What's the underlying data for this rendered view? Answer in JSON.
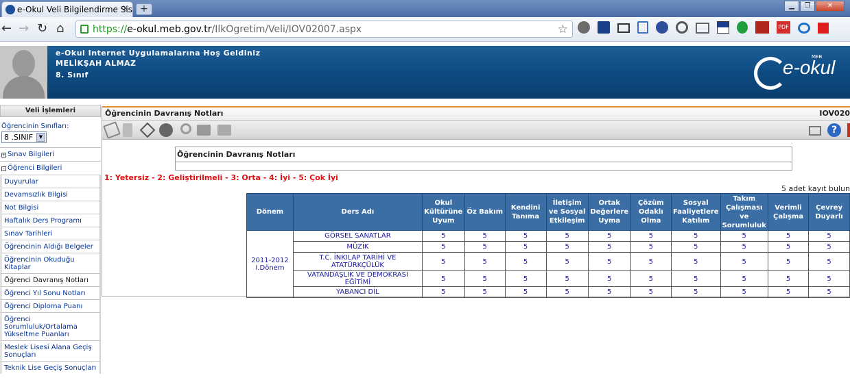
{
  "browser": {
    "tab_title": "e-Okul Veli Bilgilendirme Sistem",
    "url_scheme": "https://",
    "url_host": "e-okul.meb.gov.tr",
    "url_path": "/IlkOgretim/Veli/IOV02007.aspx"
  },
  "header": {
    "welcome": "e-Okul Internet Uygulamalarına Hoş Geldiniz",
    "student_name": "MELİKŞAH ALMAZ",
    "class_label": "8. Sınıf",
    "logo_text": "e-okul",
    "logo_sub": "MEB"
  },
  "sidebar": {
    "title": "Veli İşlemleri",
    "class_select_label": "Öğrencinin Sınıfları:",
    "class_select_value": "8 .SINIF",
    "groups": [
      {
        "label": "Sınav Bilgileri"
      },
      {
        "label": "Öğrenci Bilgileri"
      }
    ],
    "items": [
      "Duyurular",
      "Devamsızlık Bilgisi",
      "Not Bilgisi",
      "Haftalık Ders Programı",
      "Sınav Tarihleri",
      "Öğrencinin Aldığı Belgeler",
      "Öğrencinin Okuduğu Kitaplar",
      "Öğrenci Davranış Notları",
      "Öğrenci Yıl Sonu Notları",
      "Öğrenci Diploma Puanı",
      "Öğrenci Sorumluluk/Ortalama Yükseltme Puanları",
      "Meslek Lisesi Alana Geçiş Sonuçları",
      "Teknik Lise Geçiş Sonuçları"
    ]
  },
  "content": {
    "title": "Öğrencinin Davranış Notları",
    "page_code": "IOV020",
    "inner_title": "Öğrencinin  Davranış Notları",
    "legend": "1: Yetersiz - 2: Geliştirilmeli - 3: Orta - 4: İyi - 5: Çok İyi",
    "record_count": "5 adet kayıt bulun"
  },
  "table": {
    "headers": [
      "Dönem",
      "Ders Adı",
      "Okul Kültürüne Uyum",
      "Öz Bakım",
      "Kendini Tanıma",
      "İletişim ve Sosyal Etkileşim",
      "Ortak Değerlere Uyma",
      "Çözüm Odaklı Olma",
      "Sosyal Faaliyetlere Katılım",
      "Takım Çalışması ve Sorumluluk",
      "Verimli Çalışma",
      "Çevrey Duyarlı"
    ],
    "donem": "2011-2012 I.Dönem",
    "rows": [
      {
        "ders": "GÖRSEL SANATLAR",
        "scores": [
          "5",
          "5",
          "5",
          "5",
          "5",
          "5",
          "5",
          "5",
          "5",
          "5"
        ]
      },
      {
        "ders": "MÜZİK",
        "scores": [
          "5",
          "5",
          "5",
          "5",
          "5",
          "5",
          "5",
          "5",
          "5",
          "5"
        ]
      },
      {
        "ders": "T.C. İNKILAP TARİHİ VE ATATÜRKÇÜLÜK",
        "scores": [
          "5",
          "5",
          "5",
          "5",
          "5",
          "5",
          "5",
          "5",
          "5",
          "5"
        ]
      },
      {
        "ders": "VATANDAŞLIK VE DEMOKRASİ EĞİTİMİ",
        "scores": [
          "5",
          "5",
          "5",
          "5",
          "5",
          "5",
          "5",
          "5",
          "5",
          "5"
        ]
      },
      {
        "ders": "YABANCI DİL",
        "scores": [
          "5",
          "5",
          "5",
          "5",
          "5",
          "5",
          "5",
          "5",
          "5",
          "5"
        ]
      }
    ]
  }
}
